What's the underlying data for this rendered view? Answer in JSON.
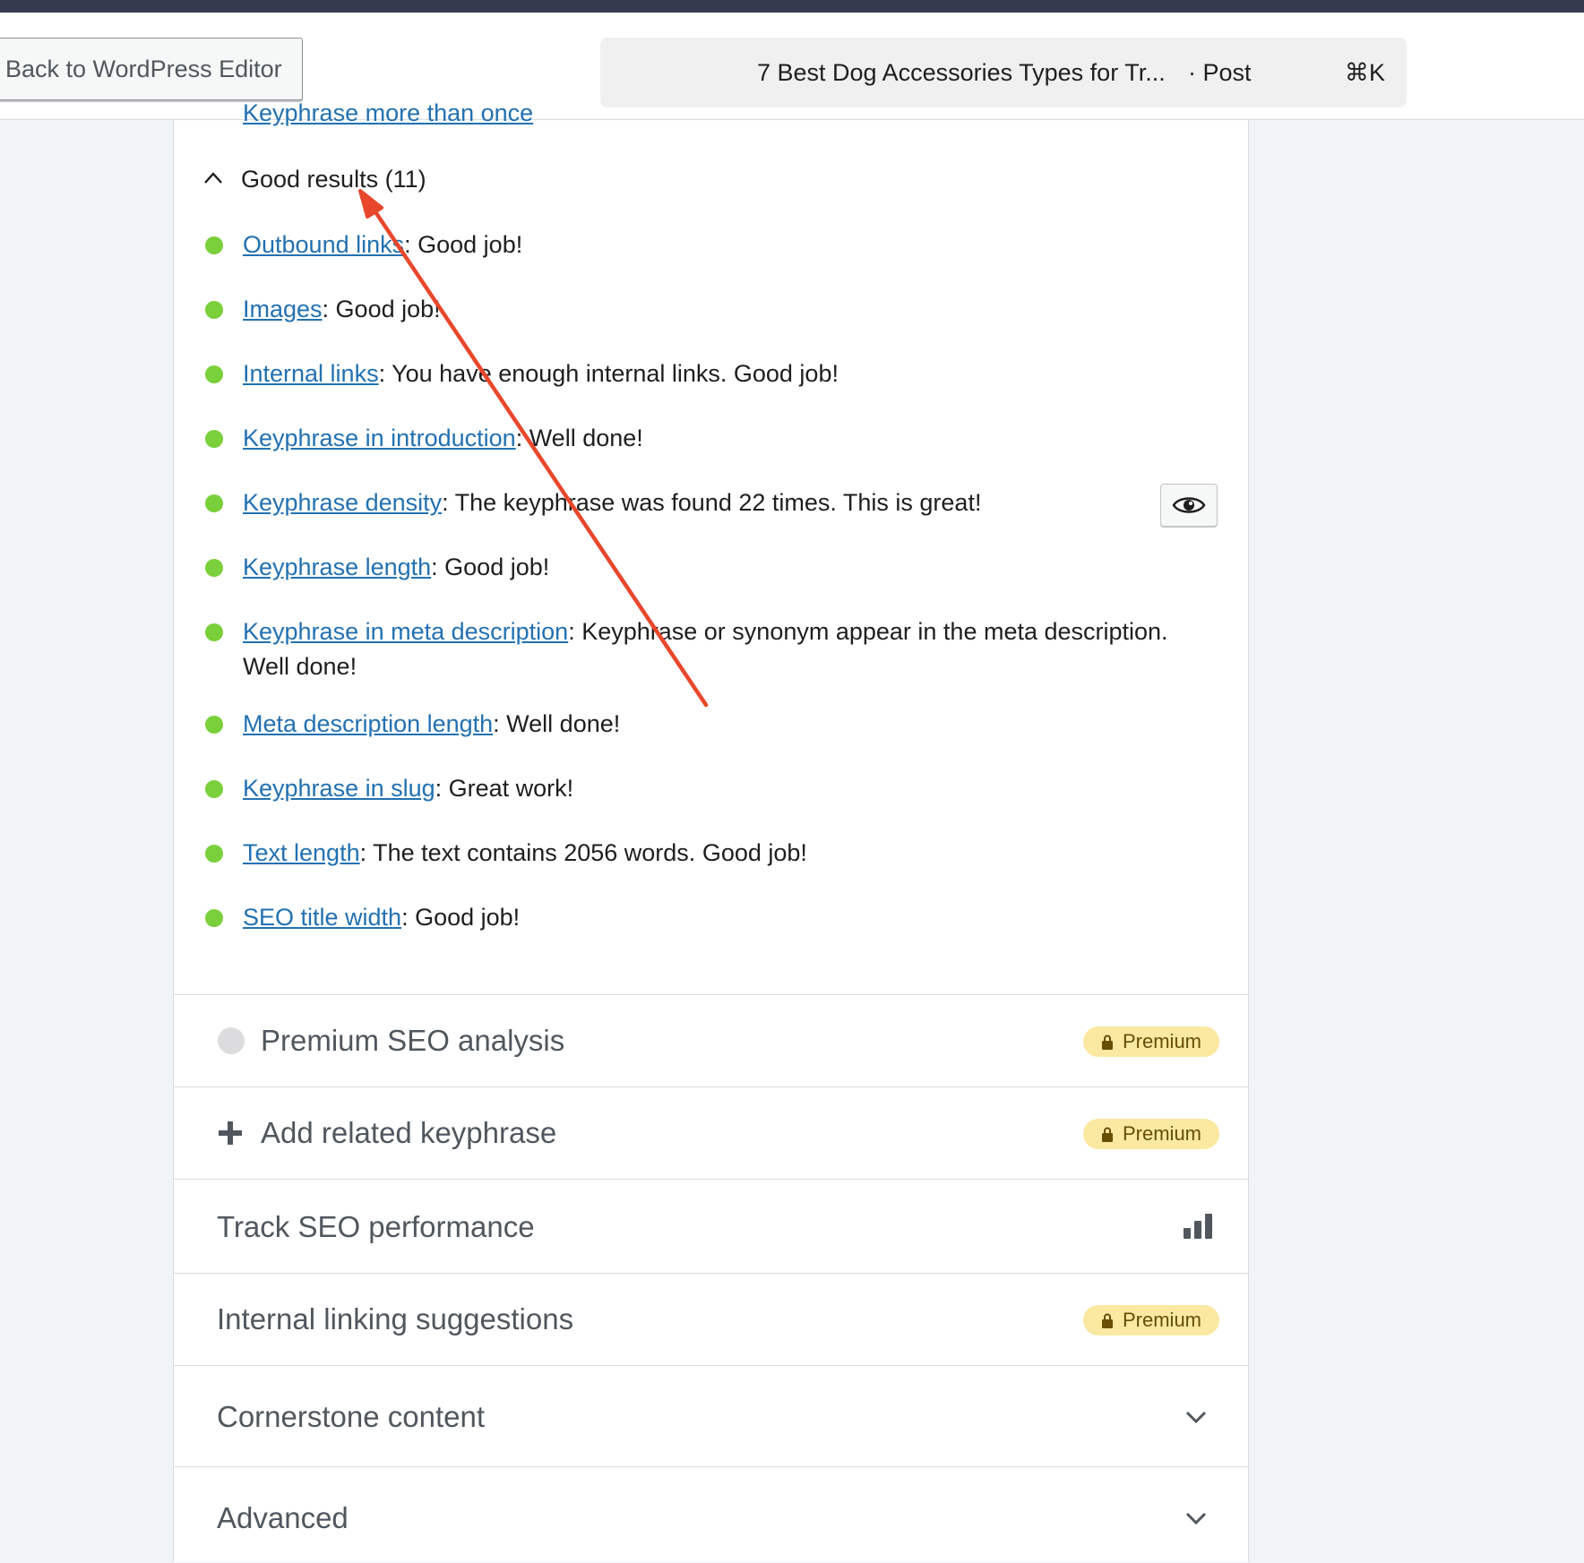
{
  "header": {
    "back_button_label": "Back to WordPress Editor",
    "command_bar": {
      "title": "7 Best Dog Accessories Types for Tr...",
      "type": "· Post",
      "shortcut": "⌘K"
    }
  },
  "analysis": {
    "cutoff_link": "Keyphrase more than once",
    "good_results": {
      "heading": "Good results (11)",
      "items": [
        {
          "link": "Outbound links",
          "text": ": Good job!"
        },
        {
          "link": "Images",
          "text": ": Good job!"
        },
        {
          "link": "Internal links",
          "text": ": You have enough internal links. Good job!"
        },
        {
          "link": "Keyphrase in introduction",
          "text": ": Well done!"
        },
        {
          "link": "Keyphrase density",
          "text": ": The keyphrase was found 22 times. This is great!"
        },
        {
          "link": "Keyphrase length",
          "text": ": Good job!"
        },
        {
          "link": "Keyphrase in meta description",
          "text": ": Keyphrase or synonym appear in the meta description. Well done!"
        },
        {
          "link": "Meta description length",
          "text": ": Well done!"
        },
        {
          "link": "Keyphrase in slug",
          "text": ": Great work!"
        },
        {
          "link": "Text length",
          "text": ": The text contains 2056 words. Good job!"
        },
        {
          "link": "SEO title width",
          "text": ": Good job!"
        }
      ]
    }
  },
  "sections": {
    "premium_seo_analysis": {
      "label": "Premium SEO analysis",
      "badge": "Premium"
    },
    "add_related_keyphrase": {
      "label": "Add related keyphrase",
      "badge": "Premium"
    },
    "track_seo_performance": {
      "label": "Track SEO performance"
    },
    "internal_linking_suggestions": {
      "label": "Internal linking suggestions",
      "badge": "Premium"
    },
    "cornerstone_content": {
      "label": "Cornerstone content"
    },
    "advanced": {
      "label": "Advanced"
    }
  },
  "colors": {
    "good_bullet": "#7ad03a",
    "link": "#2271b1",
    "premium_badge_bg": "#fbe9a2",
    "annotation_arrow": "#e8472b"
  },
  "icons": [
    "chevron-up-icon",
    "eye-icon",
    "plus-icon",
    "lock-icon",
    "bar-chart-icon",
    "chevron-down-icon"
  ]
}
